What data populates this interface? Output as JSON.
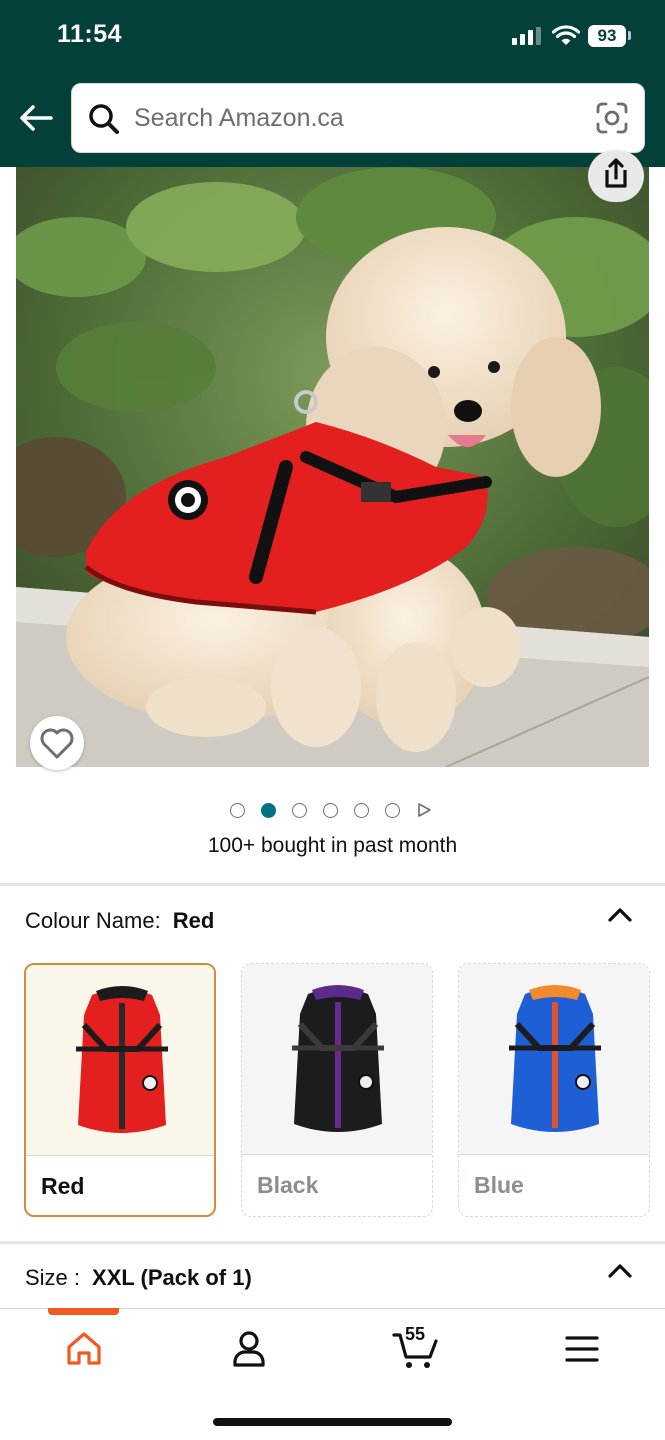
{
  "status_bar": {
    "time": "11:54",
    "battery": "93"
  },
  "search": {
    "placeholder": "Search Amazon.ca"
  },
  "carousel": {
    "total_dots": 6,
    "active_index": 1
  },
  "social_proof": "100+ bought in past month",
  "colour": {
    "label": "Colour Name:",
    "selected": "Red",
    "options": [
      {
        "name": "Red",
        "color": "#e3201f",
        "trim": "#2a2a2a",
        "collar": "#1c1c1c",
        "zip": "#2a2a2a"
      },
      {
        "name": "Black",
        "color": "#1c1c1f",
        "trim": "#6a2a8c",
        "collar": "#5c2a8a",
        "zip": "#6a2a8c"
      },
      {
        "name": "Blue",
        "color": "#1f5fd6",
        "trim": "#f27a1c",
        "collar": "#f28a2c",
        "zip": "#e0542a"
      }
    ]
  },
  "size": {
    "label": "Size :",
    "selected": "XXL (Pack of 1)"
  },
  "nav": {
    "cart_count": "55"
  },
  "colors": {
    "header": "#04403a",
    "accent": "#f05a1e",
    "link": "#007185"
  }
}
